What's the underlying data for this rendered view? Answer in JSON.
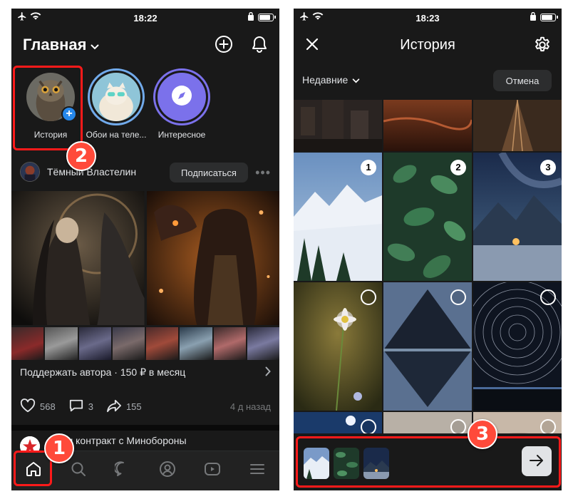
{
  "left": {
    "status": {
      "time": "18:22"
    },
    "header": {
      "title": "Главная"
    },
    "stories": [
      {
        "label": "История"
      },
      {
        "label": "Обои на теле..."
      },
      {
        "label": "Интересное"
      }
    ],
    "post": {
      "author": "Тёмный Властелин",
      "subscribe_label": "Подписаться",
      "support_text": "Поддержать автора · 150 ₽ в месяц",
      "likes": "568",
      "comments": "3",
      "shares": "155",
      "time_ago": "4 д назад"
    },
    "next_post": {
      "text": "...очи контракт с Минобороны"
    },
    "annotations": {
      "badge1": "1",
      "badge2": "2"
    }
  },
  "right": {
    "status": {
      "time": "18:23"
    },
    "header": {
      "title": "История"
    },
    "filter_label": "Недавние",
    "cancel_label": "Отмена",
    "selected": [
      "1",
      "2",
      "3"
    ],
    "annotations": {
      "badge3": "3"
    }
  },
  "icons": {
    "left_header": [
      "plus-circle-icon",
      "bell-icon"
    ],
    "tabs": [
      "home-icon",
      "search-icon",
      "chat-icon",
      "profile-icon",
      "video-icon",
      "menu-icon"
    ],
    "right_header": [
      "close-icon",
      "gear-icon"
    ]
  },
  "colors": {
    "highlight": "#ff1a1a",
    "badge": "#ff4a3a",
    "accent": "#2688eb",
    "background": "#191919"
  }
}
